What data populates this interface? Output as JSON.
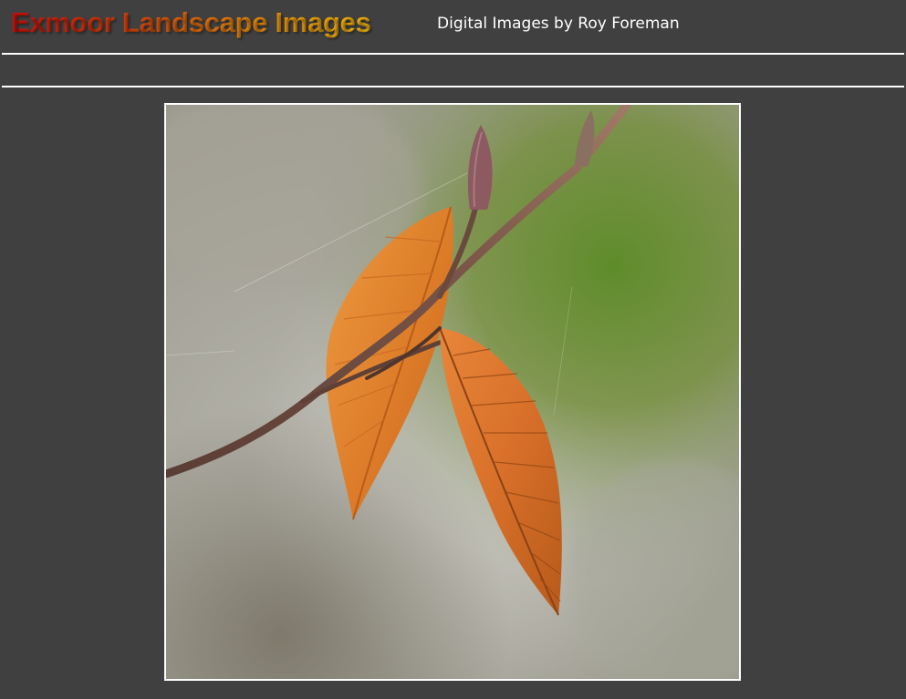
{
  "header": {
    "title": "Exmoor Landscape Images",
    "subtitle": "Digital Images by Roy Foreman"
  },
  "photo": {
    "subject": "beech-leaves-on-twig"
  },
  "colors": {
    "background": "#404040",
    "divider": "#ffffff",
    "title_start": "#c8100c",
    "title_end": "#f0b40c",
    "subtitle": "#ffffff"
  }
}
